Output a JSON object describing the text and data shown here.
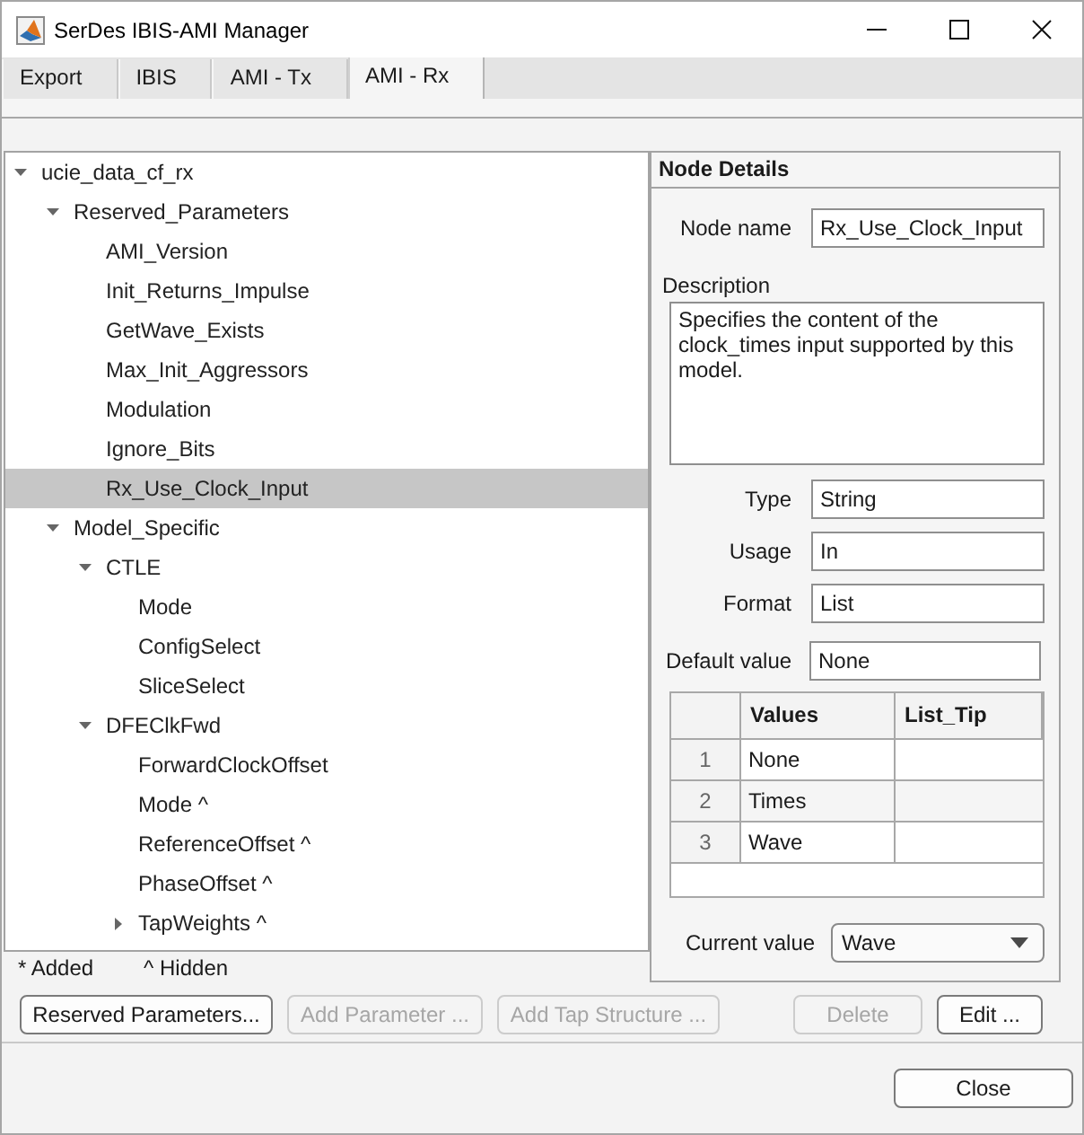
{
  "window": {
    "title": "SerDes IBIS-AMI Manager"
  },
  "tabs": [
    {
      "label": "Export",
      "selected": false
    },
    {
      "label": "IBIS",
      "selected": false
    },
    {
      "label": "AMI - Tx",
      "selected": false
    },
    {
      "label": "AMI - Rx",
      "selected": true
    }
  ],
  "tree": {
    "items": [
      {
        "label": "ucie_data_cf_rx",
        "expanded": true,
        "selected": false,
        "children": [
          {
            "label": "Reserved_Parameters",
            "expanded": true,
            "selected": false,
            "children": [
              {
                "label": "AMI_Version",
                "selected": false
              },
              {
                "label": "Init_Returns_Impulse",
                "selected": false
              },
              {
                "label": "GetWave_Exists",
                "selected": false
              },
              {
                "label": "Max_Init_Aggressors",
                "selected": false
              },
              {
                "label": "Modulation",
                "selected": false
              },
              {
                "label": "Ignore_Bits",
                "selected": false
              },
              {
                "label": "Rx_Use_Clock_Input",
                "selected": true
              }
            ]
          },
          {
            "label": "Model_Specific",
            "expanded": true,
            "selected": false,
            "children": [
              {
                "label": "CTLE",
                "expanded": true,
                "selected": false,
                "children": [
                  {
                    "label": "Mode",
                    "selected": false
                  },
                  {
                    "label": "ConfigSelect",
                    "selected": false
                  },
                  {
                    "label": "SliceSelect",
                    "selected": false
                  }
                ]
              },
              {
                "label": "DFEClkFwd",
                "expanded": true,
                "selected": false,
                "children": [
                  {
                    "label": "ForwardClockOffset",
                    "selected": false
                  },
                  {
                    "label": "Mode ^",
                    "selected": false
                  },
                  {
                    "label": "ReferenceOffset ^",
                    "selected": false
                  },
                  {
                    "label": "PhaseOffset ^",
                    "selected": false
                  },
                  {
                    "label": "TapWeights ^",
                    "expanded": false,
                    "selected": false
                  }
                ]
              }
            ]
          }
        ]
      }
    ]
  },
  "node_details": {
    "title": "Node Details",
    "node_name": {
      "label": "Node name",
      "value": "Rx_Use_Clock_Input"
    },
    "description": {
      "label": "Description",
      "value": "Specifies the content of the clock_times input supported by this model."
    },
    "properties": [
      {
        "label": "Type",
        "value": "String"
      },
      {
        "label": "Usage",
        "value": "In"
      },
      {
        "label": "Format",
        "value": "List"
      }
    ],
    "default_value": {
      "label": "Default value",
      "value": "None"
    },
    "values_table": {
      "columns": [
        "Values",
        "List_Tip"
      ],
      "rows": [
        {
          "number": "1",
          "value": "None"
        },
        {
          "number": "2",
          "value": "Times"
        },
        {
          "number": "3",
          "value": "Wave"
        }
      ]
    },
    "current_value": {
      "label": "Current value",
      "value": "Wave"
    }
  },
  "legend": [
    "* Added",
    "^ Hidden"
  ],
  "buttons": [
    {
      "label": "Reserved Parameters...",
      "disabled": false
    },
    {
      "label": "Add Parameter ...",
      "disabled": true
    },
    {
      "label": "Add Tap Structure ...",
      "disabled": true
    },
    {
      "label": "Delete",
      "disabled": true
    },
    {
      "label": "Edit ...",
      "disabled": false
    }
  ],
  "dialog_buttons": [
    {
      "label": "Close",
      "disabled": false
    }
  ]
}
